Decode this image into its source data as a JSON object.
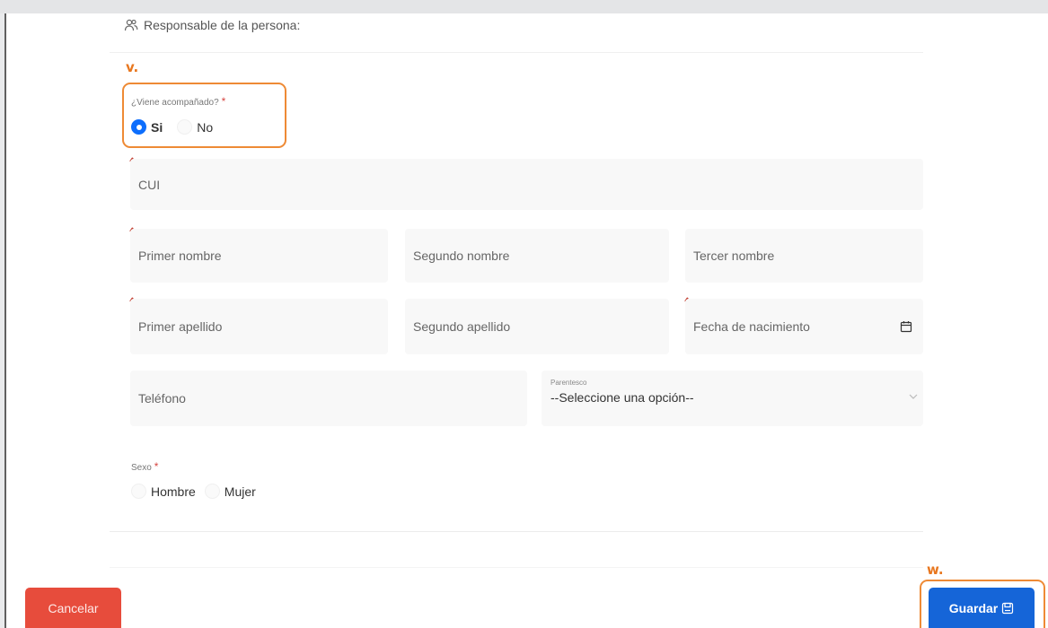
{
  "section": {
    "title": "Responsable de la persona:",
    "icon": "users-icon"
  },
  "annotations": {
    "v": "v.",
    "w": "w.",
    "color": "#e8771f"
  },
  "accompanied": {
    "label": "¿Viene acompañado?",
    "required_mark": "*",
    "options": [
      "Si",
      "No"
    ],
    "selected": "Si"
  },
  "fields": {
    "cui": "CUI",
    "first_name": "Primer nombre",
    "second_name": "Segundo nombre",
    "third_name": "Tercer nombre",
    "first_surname": "Primer apellido",
    "second_surname": "Segundo apellido",
    "birth_date": "Fecha de nacimiento",
    "phone": "Teléfono"
  },
  "relationship": {
    "label": "Parentesco",
    "value": "--Seleccione una opción--"
  },
  "sex": {
    "label": "Sexo",
    "required_mark": "*",
    "options": [
      "Hombre",
      "Mujer"
    ]
  },
  "buttons": {
    "cancel": "Cancelar",
    "save": "Guardar",
    "cancel_color": "#e74c3c",
    "save_color": "#1565d8"
  }
}
